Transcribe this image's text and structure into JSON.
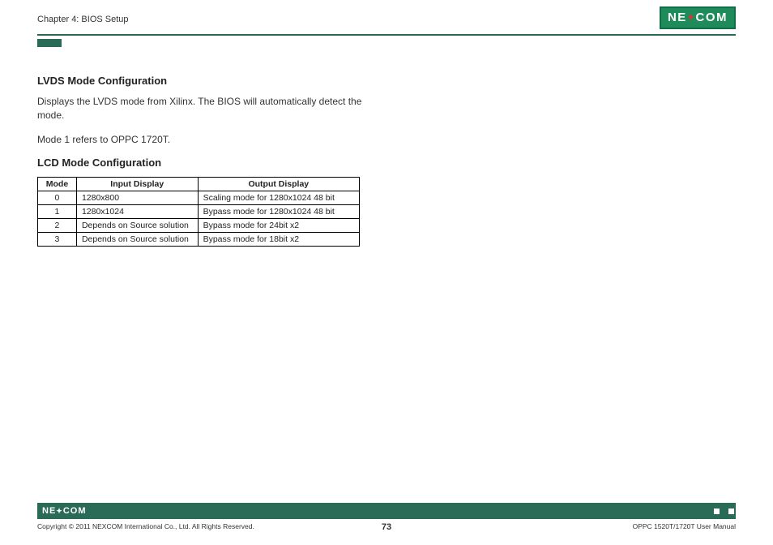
{
  "header": {
    "chapter": "Chapter 4: BIOS Setup",
    "logo_text": "NE COM"
  },
  "sections": {
    "lvds": {
      "title": "LVDS Mode Configuration",
      "para1": "Displays the LVDS mode from Xilinx. The BIOS will automatically detect the mode.",
      "para2": "Mode 1 refers to OPPC 1720T."
    },
    "lcd": {
      "title": "LCD Mode Configuration",
      "table": {
        "headers": {
          "mode": "Mode",
          "input": "Input Display",
          "output": "Output Display"
        },
        "rows": [
          {
            "mode": "0",
            "input": "1280x800",
            "output": "Scaling mode for 1280x1024 48 bit"
          },
          {
            "mode": "1",
            "input": "1280x1024",
            "output": "Bypass mode for 1280x1024 48 bit"
          },
          {
            "mode": "2",
            "input": "Depends on Source solution",
            "output": "Bypass mode for 24bit x2"
          },
          {
            "mode": "3",
            "input": "Depends on Source solution",
            "output": "Bypass mode for 18bit x2"
          }
        ]
      }
    }
  },
  "footer": {
    "logo": "NE COM",
    "copyright": "Copyright © 2011 NEXCOM International Co., Ltd. All Rights Reserved.",
    "page": "73",
    "manual": "OPPC 1520T/1720T User Manual"
  }
}
